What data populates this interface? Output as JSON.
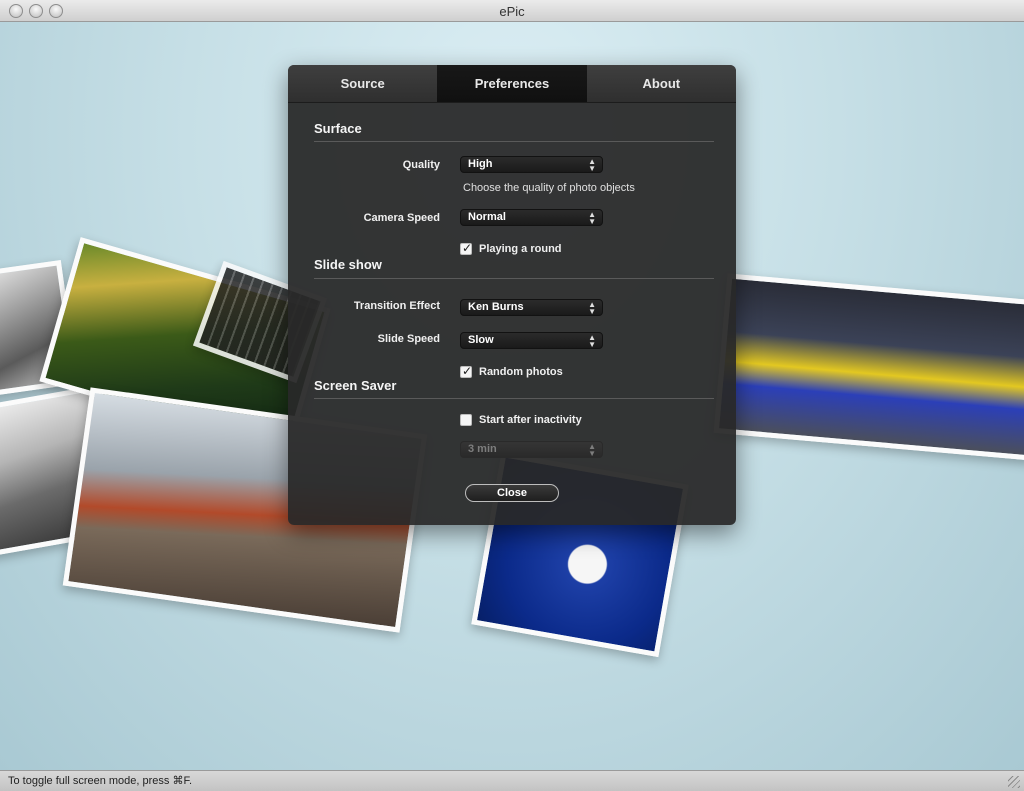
{
  "window": {
    "title": "ePic"
  },
  "tabs": [
    {
      "label": "Source"
    },
    {
      "label": "Preferences"
    },
    {
      "label": "About"
    }
  ],
  "surface": {
    "title": "Surface",
    "quality_label": "Quality",
    "quality_value": "High",
    "quality_hint": "Choose the quality of photo objects",
    "camera_label": "Camera Speed",
    "camera_value": "Normal",
    "playing_label": "Playing a round",
    "playing_checked": true
  },
  "slideshow": {
    "title": "Slide show",
    "transition_label": "Transition Effect",
    "transition_value": "Ken Burns",
    "speed_label": "Slide Speed",
    "speed_value": "Slow",
    "random_label": "Random photos",
    "random_checked": true
  },
  "screensaver": {
    "title": "Screen Saver",
    "start_label": "Start after inactivity",
    "start_checked": false,
    "delay_value": "3 min"
  },
  "close_label": "Close",
  "status": {
    "text": "To toggle full screen mode, press ⌘F."
  },
  "icons": [
    "close-window-icon",
    "minimize-window-icon",
    "zoom-window-icon",
    "select-arrows-icon",
    "checkmark-icon",
    "resize-grip-icon"
  ]
}
